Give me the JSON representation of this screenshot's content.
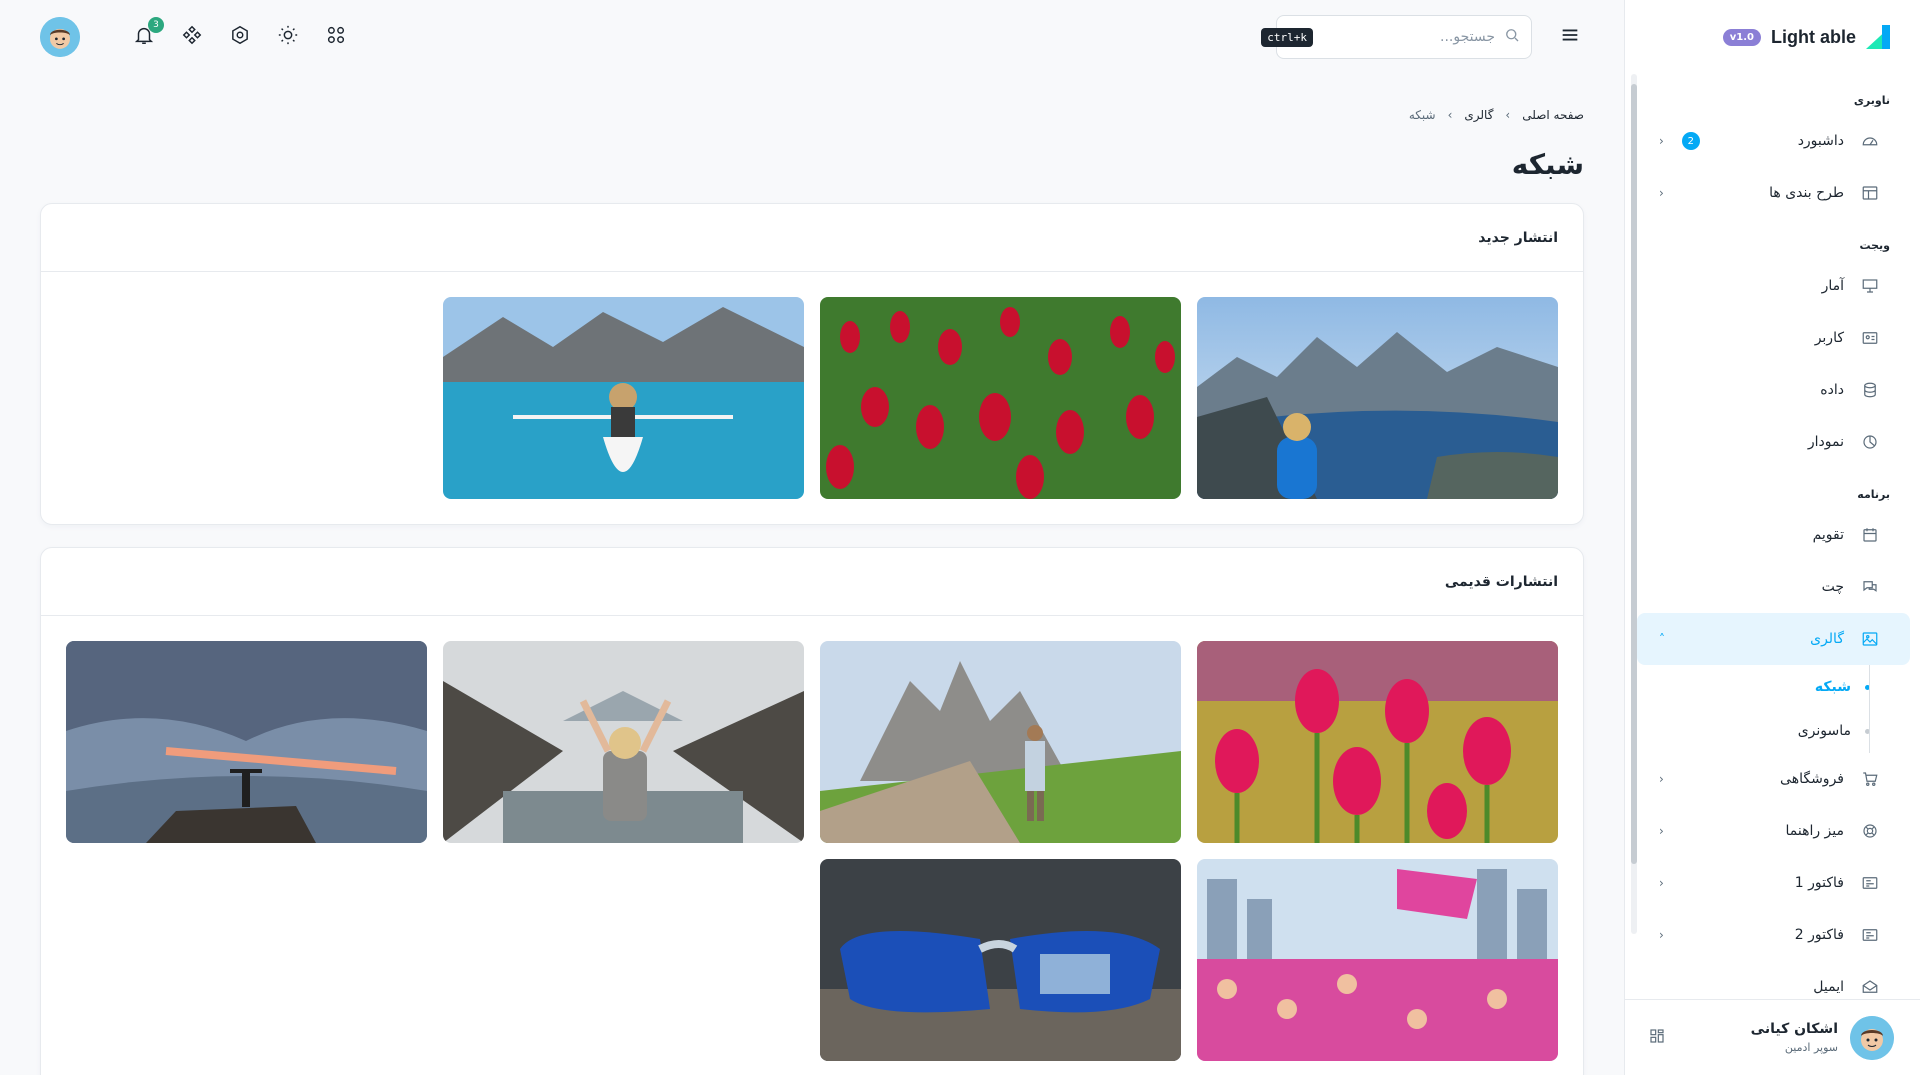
{
  "sidebar": {
    "brand": "Light able",
    "version": "v1.0",
    "sections": {
      "nav": "ناوبری",
      "widget": "ویجت",
      "apps": "برنامه"
    },
    "items": {
      "dashboard": "داشبورد",
      "dashboard_count": "2",
      "layouts": "طرح بندی ها",
      "stats": "آمار",
      "user": "کاربر",
      "data": "داده",
      "chart": "نمودار",
      "calendar": "تقویم",
      "chat": "چت",
      "gallery": "گالری",
      "gallery_grid": "شبکه",
      "gallery_masonry": "ماسونری",
      "shop": "فروشگاهی",
      "helpdesk": "میز راهنما",
      "invoice1": "فاکتور 1",
      "invoice2": "فاکتور 2",
      "email": "ایمیل"
    },
    "user": {
      "name": "اشکان کیانی",
      "role": "سوپر ادمین"
    }
  },
  "header": {
    "search_placeholder": "جستجو...",
    "shortcut": "ctrl+k",
    "notification_count": "3"
  },
  "breadcrumb": [
    "صفحه اصلی",
    "گالری",
    "شبکه"
  ],
  "page_title": "شبکه",
  "cards": {
    "new": {
      "title": "انتشار جدید"
    },
    "old": {
      "title": "انتشارات قدیمی"
    }
  },
  "colors": {
    "primary": "#04a9f5",
    "accent": "#1de9b6",
    "version_badge": "#8b7fd6",
    "notification_badge": "#2ca87f"
  }
}
